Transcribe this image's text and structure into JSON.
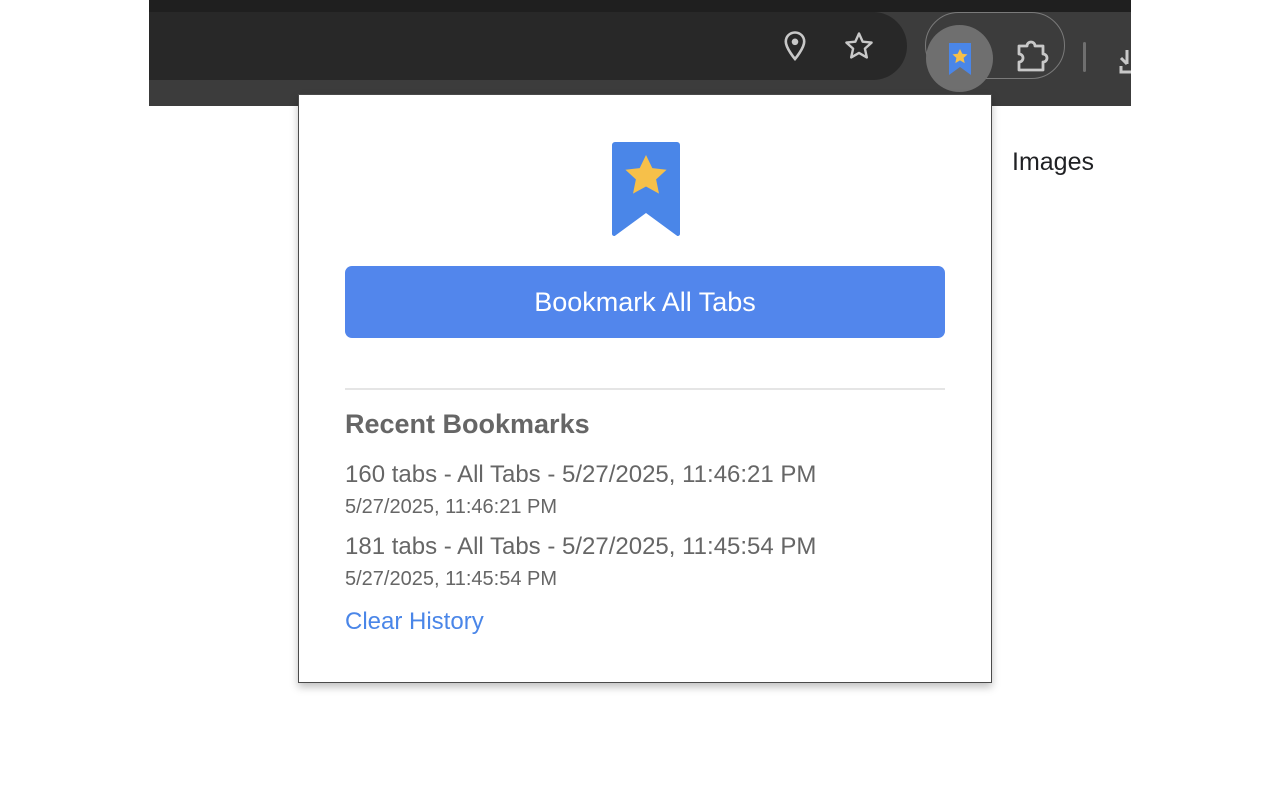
{
  "browser": {
    "icons": {
      "location": "location-pin-icon",
      "star": "star-outline-icon",
      "extension": "bookmark-star-icon",
      "extensions_menu": "puzzle-icon",
      "download": "download-icon"
    }
  },
  "page": {
    "nav_link": "Images"
  },
  "popup": {
    "logo_icon": "bookmark-star-icon",
    "bookmark_all_label": "Bookmark All Tabs",
    "recent_title": "Recent Bookmarks",
    "items": [
      {
        "title": "160 tabs - All Tabs - 5/27/2025, 11:46:21 PM",
        "date": "5/27/2025, 11:46:21 PM"
      },
      {
        "title": "181 tabs - All Tabs - 5/27/2025, 11:45:54 PM",
        "date": "5/27/2025, 11:45:54 PM"
      }
    ],
    "clear_label": "Clear History"
  },
  "colors": {
    "accent": "#5286ec",
    "link": "#4a86e8",
    "star": "#f6c04a",
    "text_muted": "#666666",
    "toolbar": "#3c3c3c"
  }
}
